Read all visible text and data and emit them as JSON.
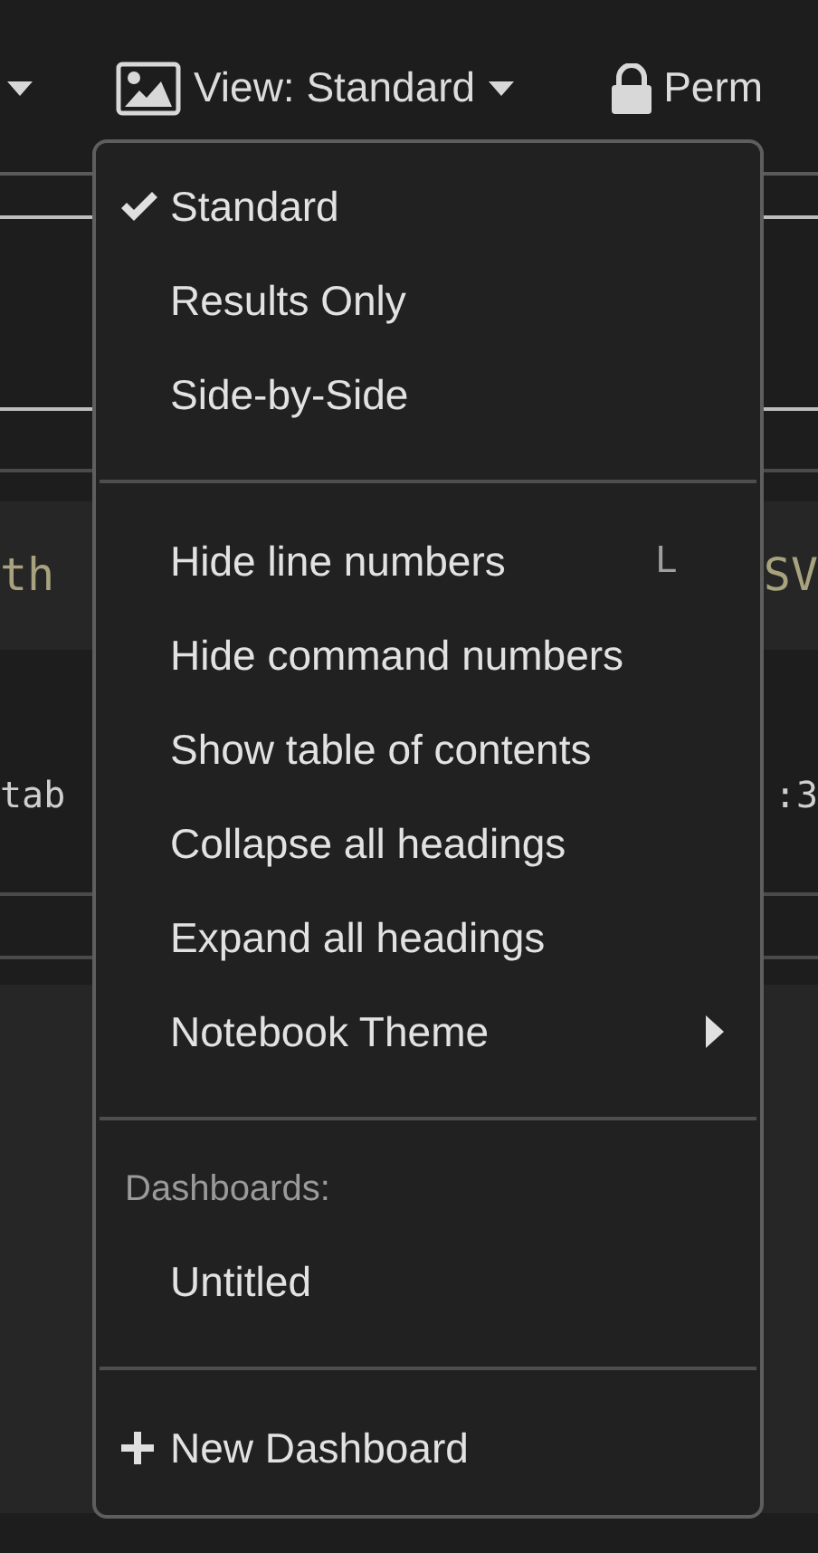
{
  "toolbar": {
    "view_button": {
      "label": "View: Standard"
    },
    "permissions_button": {
      "label": "Perm"
    }
  },
  "background": {
    "code_left": "th",
    "code_right": "SV",
    "output_left": "tab",
    "output_right": ":3"
  },
  "view_menu": {
    "sections": [
      {
        "items": [
          {
            "kind": "option",
            "label": "Standard",
            "checked": true
          },
          {
            "kind": "option",
            "label": "Results Only",
            "checked": false
          },
          {
            "kind": "option",
            "label": "Side-by-Side",
            "checked": false
          }
        ]
      },
      {
        "items": [
          {
            "kind": "action",
            "label": "Hide line numbers",
            "shortcut": "L"
          },
          {
            "kind": "action",
            "label": "Hide command numbers"
          },
          {
            "kind": "action",
            "label": "Show table of contents"
          },
          {
            "kind": "action",
            "label": "Collapse all headings"
          },
          {
            "kind": "action",
            "label": "Expand all headings"
          },
          {
            "kind": "submenu",
            "label": "Notebook Theme"
          }
        ]
      },
      {
        "header": "Dashboards:",
        "items": [
          {
            "kind": "action",
            "label": "Untitled"
          }
        ]
      },
      {
        "items": [
          {
            "kind": "add",
            "label": "New Dashboard"
          }
        ]
      }
    ]
  }
}
